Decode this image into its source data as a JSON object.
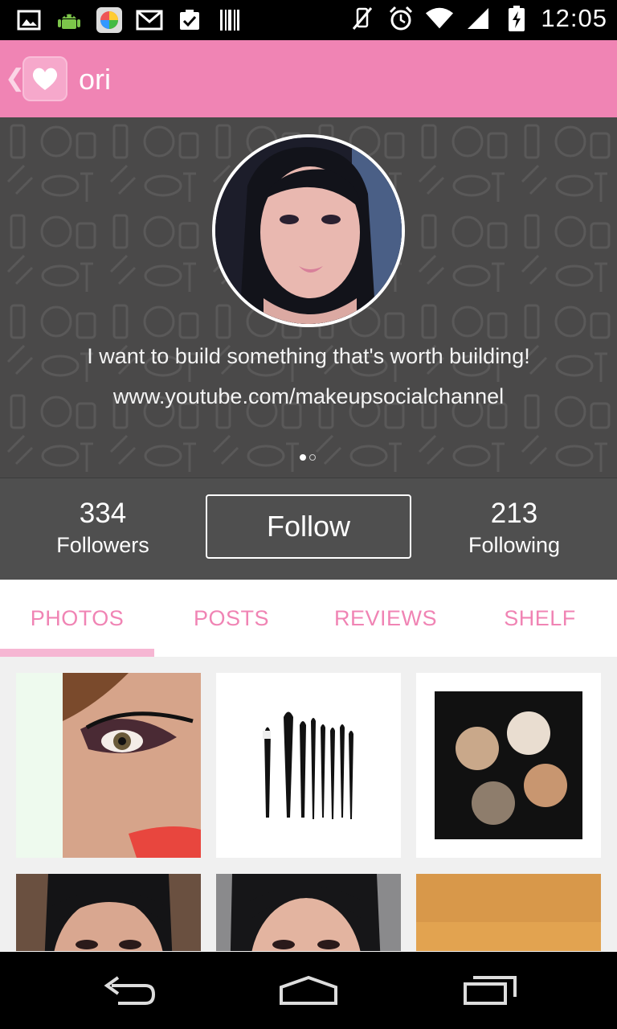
{
  "status_bar": {
    "time": "12:05",
    "left_icons": [
      "gallery-icon",
      "android-debug-icon",
      "app-icon",
      "gmail-icon",
      "task-icon",
      "barcode-icon"
    ],
    "right_icons": [
      "vibrate-off-icon",
      "alarm-icon",
      "wifi-icon",
      "signal-icon",
      "battery-charging-icon"
    ]
  },
  "action_bar": {
    "title": "ori",
    "back_glyph": "❮"
  },
  "profile": {
    "bio": "I want to build something that's worth building!",
    "link": "www.youtube.com/makeupsocialchannel",
    "pager_dots": 2,
    "pager_active": 0
  },
  "stats": {
    "followers_count": "334",
    "followers_label": "Followers",
    "follow_button": "Follow",
    "following_count": "213",
    "following_label": "Following"
  },
  "tabs": [
    {
      "label": "PHOTOS",
      "active": true
    },
    {
      "label": "POSTS",
      "active": false
    },
    {
      "label": "REVIEWS",
      "active": false
    },
    {
      "label": "SHELF",
      "active": false
    }
  ],
  "colors": {
    "accent_pink": "#f084b4",
    "hero_bg": "#4a4949",
    "stats_bg": "#4f4f4f"
  },
  "nav": {
    "buttons": [
      "back-nav-icon",
      "home-nav-icon",
      "recents-nav-icon"
    ]
  }
}
